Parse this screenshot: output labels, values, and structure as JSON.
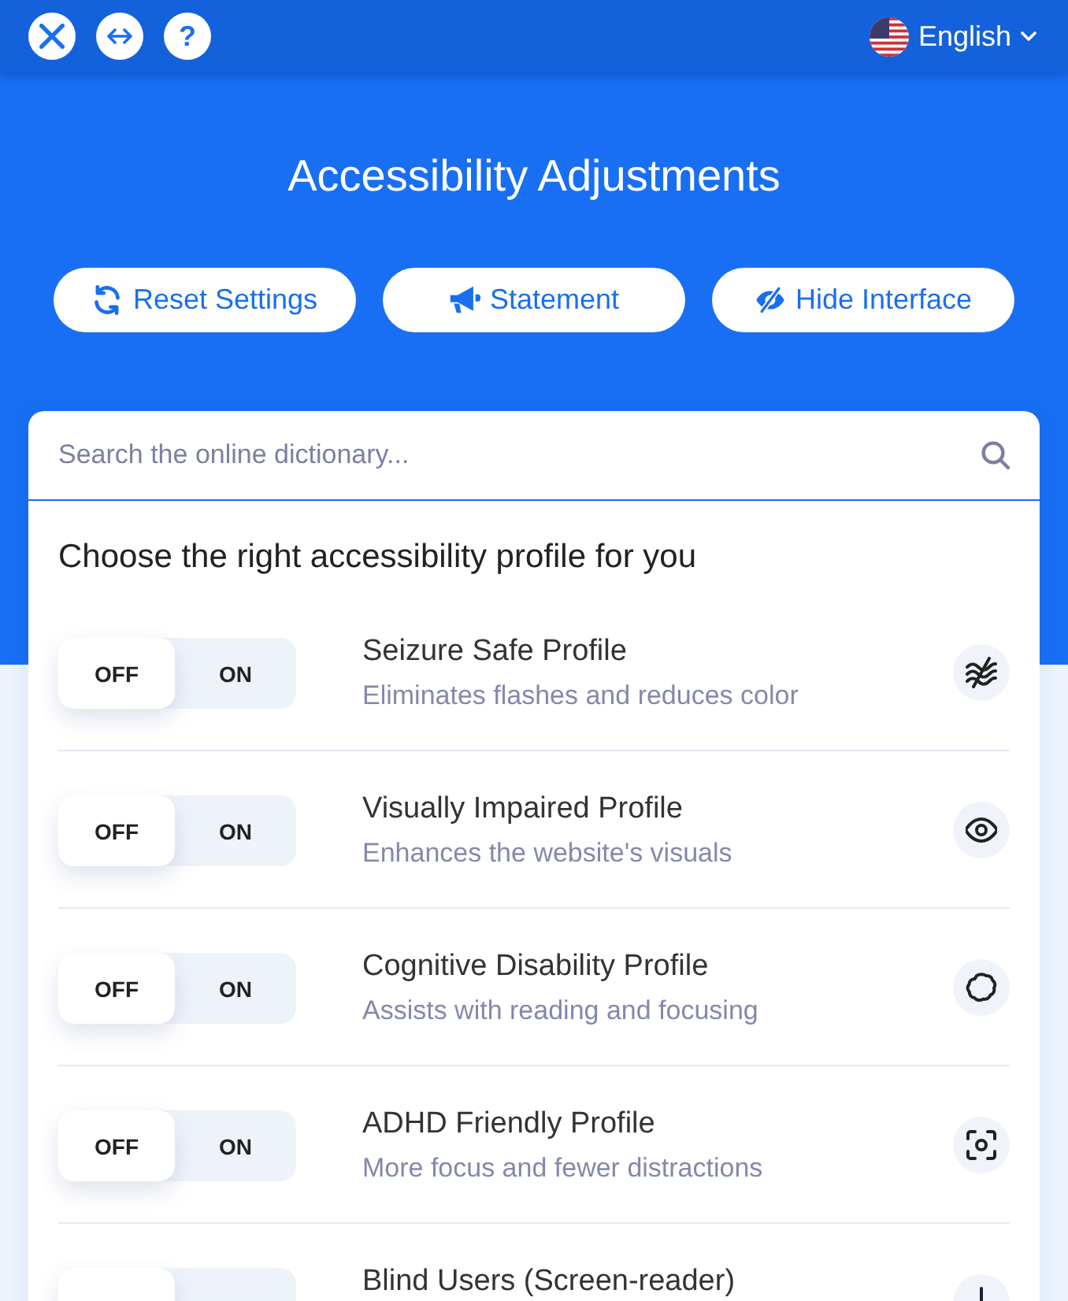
{
  "top_bar": {
    "help_button": {
      "label": "?"
    },
    "language": {
      "label": "English"
    }
  },
  "header": {
    "title": "Accessibility Adjustments",
    "buttons": [
      {
        "label": "Reset Settings"
      },
      {
        "label": "Statement"
      },
      {
        "label": "Hide Interface"
      }
    ]
  },
  "search": {
    "placeholder": "Search the online dictionary..."
  },
  "profiles_heading": "Choose the right accessibility profile for you",
  "profiles": [
    {
      "title": "Seizure Safe Profile",
      "description": "Eliminates flashes and reduces color",
      "toggle": {
        "off_label": "OFF",
        "on_label": "ON",
        "on": false
      }
    },
    {
      "title": "Visually Impaired Profile",
      "description": "Enhances the website's visuals",
      "toggle": {
        "off_label": "OFF",
        "on_label": "ON",
        "on": false
      }
    },
    {
      "title": "Cognitive Disability Profile",
      "description": "Assists with reading and focusing",
      "toggle": {
        "off_label": "OFF",
        "on_label": "ON",
        "on": false
      }
    },
    {
      "title": "ADHD Friendly Profile",
      "description": "More focus and fewer distractions",
      "toggle": {
        "off_label": "OFF",
        "on_label": "ON",
        "on": false
      }
    },
    {
      "title": "Blind Users (Screen-reader)",
      "toggle": {
        "on": false
      }
    }
  ]
}
